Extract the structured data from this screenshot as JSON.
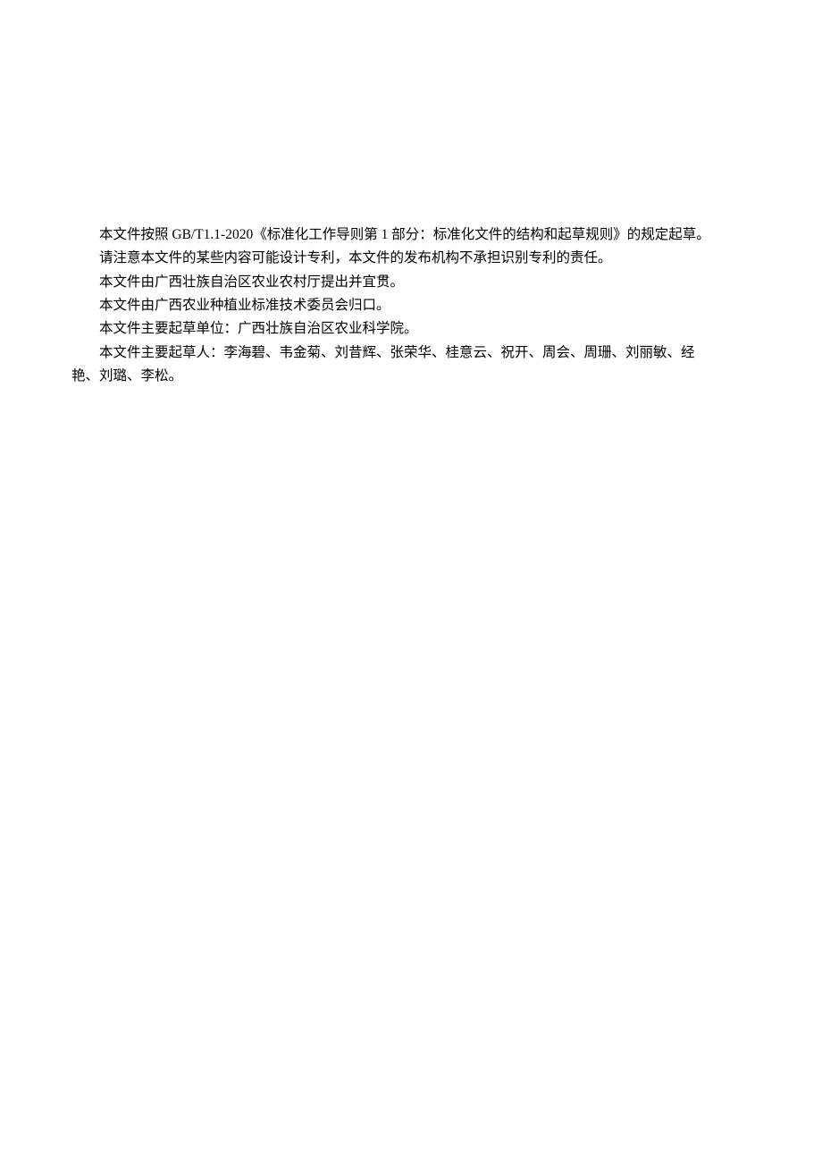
{
  "paragraphs": {
    "p1": "本文件按照 GB/T1.1-2020《标准化工作导则第 1 部分：标准化文件的结构和起草规则》的规定起草。",
    "p2": "请注意本文件的某些内容可能设计专利，本文件的发布机构不承担识别专利的责任。",
    "p3": "本文件由广西壮族自治区农业农村厅提出并宜贯。",
    "p4": "本文件由广西农业种植业标准技术委员会归口。",
    "p5": "本文件主要起草单位：广西壮族自治区农业科学院。",
    "p6_part1": "本文件主要起草人：李海碧、韦金菊、刘昔辉、张荣华、桂意云、祝开、周会、周珊、刘丽敏、经",
    "p6_part2": "艳、刘璐、李松。"
  }
}
